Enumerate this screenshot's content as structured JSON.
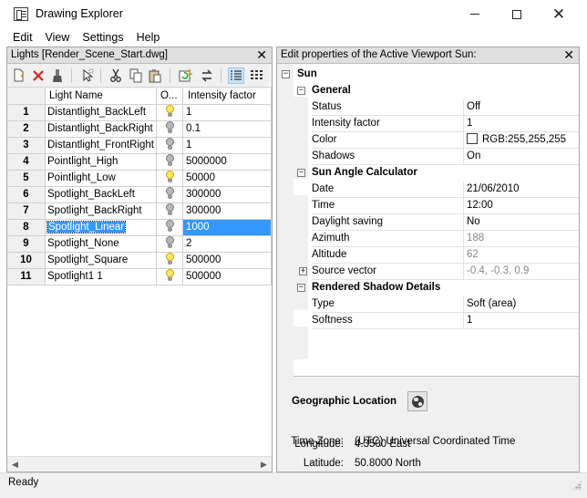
{
  "window": {
    "title": "Drawing Explorer"
  },
  "menu": [
    "Edit",
    "View",
    "Settings",
    "Help"
  ],
  "lights_panel": {
    "title": "Lights [Render_Scene_Start.dwg]",
    "columns": {
      "name": "Light Name",
      "on": "O...",
      "intensity": "Intensity factor"
    },
    "rows": [
      {
        "num": "1",
        "name": "Distantlight_BackLeft",
        "on": true,
        "intensity": "1"
      },
      {
        "num": "2",
        "name": "Distantlight_BackRight",
        "on": false,
        "intensity": "0.1"
      },
      {
        "num": "3",
        "name": "Distantlight_FrontRight",
        "on": false,
        "intensity": "1"
      },
      {
        "num": "4",
        "name": "Pointlight_High",
        "on": false,
        "intensity": "5000000"
      },
      {
        "num": "5",
        "name": "Pointlight_Low",
        "on": true,
        "intensity": "50000"
      },
      {
        "num": "6",
        "name": "Spotlight_BackLeft",
        "on": false,
        "intensity": "300000"
      },
      {
        "num": "7",
        "name": "Spotlight_BackRight",
        "on": false,
        "intensity": "300000"
      },
      {
        "num": "8",
        "name": "Spotlight_Linear",
        "on": false,
        "intensity": "1000",
        "selected": true
      },
      {
        "num": "9",
        "name": "Spotlight_None",
        "on": false,
        "intensity": "2"
      },
      {
        "num": "10",
        "name": "Spotlight_Square",
        "on": true,
        "intensity": "500000"
      },
      {
        "num": "11",
        "name": "Spotlight1 1",
        "on": true,
        "intensity": "500000"
      }
    ]
  },
  "props_panel": {
    "title": "Edit properties of the Active Viewport Sun:",
    "root": "Sun",
    "sections": {
      "general": {
        "title": "General",
        "status": {
          "label": "Status",
          "value": "Off"
        },
        "intensity": {
          "label": "Intensity factor",
          "value": "1"
        },
        "color": {
          "label": "Color",
          "value": "RGB:255,255,255"
        },
        "shadows": {
          "label": "Shadows",
          "value": "On"
        }
      },
      "angle": {
        "title": "Sun Angle Calculator",
        "date": {
          "label": "Date",
          "value": "21/06/2010"
        },
        "time": {
          "label": "Time",
          "value": "12:00"
        },
        "daylight": {
          "label": "Daylight saving",
          "value": "No"
        },
        "azimuth": {
          "label": "Azimuth",
          "value": "188"
        },
        "altitude": {
          "label": "Altitude",
          "value": "62"
        },
        "source": {
          "label": "Source vector",
          "value": "-0.4, -0.3, 0.9"
        }
      },
      "shadow": {
        "title": "Rendered Shadow Details",
        "type": {
          "label": "Type",
          "value": "Soft (area)"
        },
        "softness": {
          "label": "Softness",
          "value": "1"
        }
      }
    },
    "geo": {
      "title": "Geographic Location",
      "timezone": {
        "label": "Time Zone:",
        "value": "(UTC) Universal Coordinated Time"
      },
      "latitude": {
        "label": "Latitude:",
        "value": "50.8000 North"
      },
      "longitude": {
        "label": "Longitude:",
        "value": "4.3500 East"
      }
    }
  },
  "status": {
    "text": "Ready"
  },
  "colors": {
    "selection": "#3399ff",
    "bulb_on": "#ffe866",
    "bulb_off": "#b8b8b8"
  }
}
